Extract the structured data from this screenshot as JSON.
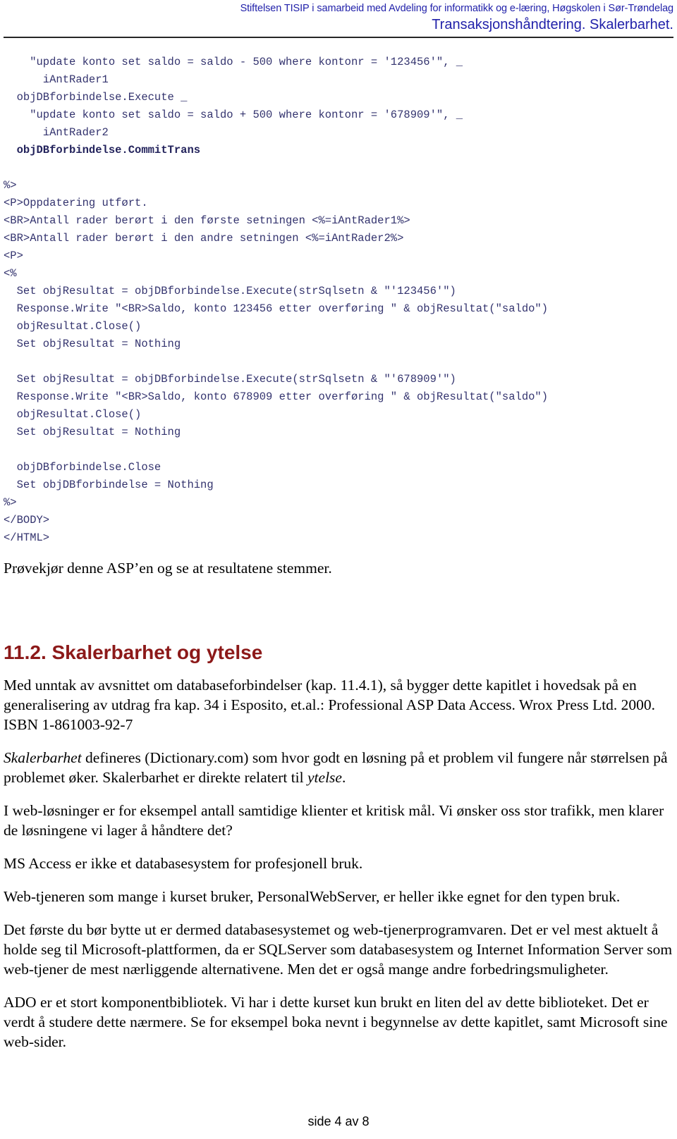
{
  "header": {
    "line1": "Stiftelsen TISIP i samarbeid med Avdeling for informatikk og e-læring, Høgskolen i Sør-Trøndelag",
    "line2": "Transaksjonshåndtering. Skalerbarhet.",
    "color": "#2222aa",
    "rule_color": "#262626"
  },
  "code": {
    "language": "asp-vbscript",
    "color": "#33336e",
    "lines": [
      {
        "text": "    \"update konto set saldo = saldo - 500 where kontonr = '123456'\", _",
        "bold": false
      },
      {
        "text": "      iAntRader1",
        "bold": false
      },
      {
        "text": "  objDBforbindelse.Execute _",
        "bold": false
      },
      {
        "text": "    \"update konto set saldo = saldo + 500 where kontonr = '678909'\", _",
        "bold": false
      },
      {
        "text": "      iAntRader2",
        "bold": false
      },
      {
        "text": "  objDBforbindelse.CommitTrans",
        "bold": true
      },
      {
        "text": "",
        "bold": false
      },
      {
        "text": "%>",
        "bold": false
      },
      {
        "text": "<P>Oppdatering utført.",
        "bold": false
      },
      {
        "text": "<BR>Antall rader berørt i den første setningen <%=iAntRader1%>",
        "bold": false
      },
      {
        "text": "<BR>Antall rader berørt i den andre setningen <%=iAntRader2%>",
        "bold": false
      },
      {
        "text": "<P>",
        "bold": false
      },
      {
        "text": "<%",
        "bold": false
      },
      {
        "text": "  Set objResultat = objDBforbindelse.Execute(strSqlsetn & \"'123456'\")",
        "bold": false
      },
      {
        "text": "  Response.Write \"<BR>Saldo, konto 123456 etter overføring \" & objResultat(\"saldo\")",
        "bold": false
      },
      {
        "text": "  objResultat.Close()",
        "bold": false
      },
      {
        "text": "  Set objResultat = Nothing",
        "bold": false
      },
      {
        "text": "",
        "bold": false
      },
      {
        "text": "  Set objResultat = objDBforbindelse.Execute(strSqlsetn & \"'678909'\")",
        "bold": false
      },
      {
        "text": "  Response.Write \"<BR>Saldo, konto 678909 etter overføring \" & objResultat(\"saldo\")",
        "bold": false
      },
      {
        "text": "  objResultat.Close()",
        "bold": false
      },
      {
        "text": "  Set objResultat = Nothing",
        "bold": false
      },
      {
        "text": "",
        "bold": false
      },
      {
        "text": "  objDBforbindelse.Close",
        "bold": false
      },
      {
        "text": "  Set objDBforbindelse = Nothing",
        "bold": false
      },
      {
        "text": "%>",
        "bold": false
      },
      {
        "text": "</BODY>",
        "bold": false
      },
      {
        "text": "</HTML>",
        "bold": false
      }
    ]
  },
  "intro_paragraph": "Prøvekjør denne ASP’en og se at resultatene stemmer.",
  "section": {
    "number": "11.2.",
    "title": "Skalerbarhet og ytelse",
    "heading_full": "11.2. Skalerbarhet og ytelse",
    "color": "#8c1919"
  },
  "paragraphs": {
    "p1": "Med unntak av avsnittet om databaseforbindelser (kap. 11.4.1), så bygger dette kapitlet i hovedsak på en generalisering av utdrag fra kap. 34 i Esposito, et.al.: Professional ASP Data Access. Wrox Press Ltd. 2000. ISBN 1-861003-92-7",
    "p2_part1_italic": "Skalerbarhet",
    "p2_part2": " defineres (Dictionary.com) som hvor godt en løsning på et problem vil fungere når størrelsen på problemet øker. Skalerbarhet er direkte relatert til ",
    "p2_part3_italic": "ytelse",
    "p2_part4": ".",
    "p3": "I web-løsninger er for eksempel antall samtidige klienter et kritisk mål. Vi ønsker oss stor trafikk, men klarer de løsningene vi lager å håndtere det?",
    "p4": "MS Access er ikke et databasesystem for profesjonell bruk.",
    "p5": "Web-tjeneren som mange i kurset bruker, PersonalWebServer, er heller ikke egnet for den typen bruk.",
    "p6": "Det første du bør bytte ut er dermed databasesystemet og web-tjenerprogramvaren. Det er vel mest aktuelt å holde seg til Microsoft-plattformen, da er SQLServer som databasesystem og Internet Information Server som web-tjener de mest nærliggende alternativene. Men det er også mange andre forbedringsmuligheter.",
    "p7": "ADO er et stort komponentbibliotek. Vi har i dette kurset kun brukt en liten del av dette biblioteket. Det er verdt å studere dette nærmere. Se for eksempel boka nevnt i begynnelse av dette kapitlet, samt Microsoft sine web-sider."
  },
  "footer": {
    "page_label": "side 4 av 8"
  }
}
